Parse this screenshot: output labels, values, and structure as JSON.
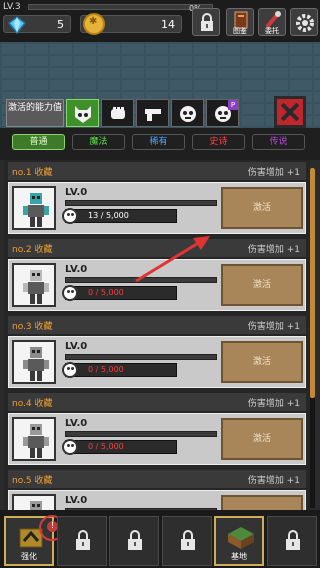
{
  "top": {
    "level": "LV.3",
    "xp_percent_label": "0%",
    "xp_fraction": 0,
    "gems": "5",
    "coins": "14",
    "buttons": [
      {
        "name": "lock-icon",
        "label": ""
      },
      {
        "name": "book-icon",
        "label": "图鉴"
      },
      {
        "name": "wrench-icon",
        "label": "委托"
      },
      {
        "name": "gear-icon",
        "label": ""
      }
    ]
  },
  "abilities": {
    "label": "激活的能力值",
    "icons": [
      "skull-cat-icon",
      "fist-icon",
      "gun-icon",
      "radiation-skull-icon",
      "radiation-skull-p-icon"
    ],
    "active_index": 0,
    "badge": "P"
  },
  "rarity_tabs": [
    {
      "label": "普通",
      "color": "#e8ffd8"
    },
    {
      "label": "魔法",
      "color": "#5fe04a"
    },
    {
      "label": "稀有",
      "color": "#4aa6ff"
    },
    {
      "label": "史诗",
      "color": "#ff4040"
    },
    {
      "label": "传说",
      "color": "#b84ad8"
    }
  ],
  "cards": [
    {
      "no": "no.1 收藏",
      "bonus": "伤害增加 +1",
      "level": "LV.0",
      "souls": "13 / 5,000",
      "souls_fraction": 0.0026,
      "souls_zero": false,
      "activate": "激活"
    },
    {
      "no": "no.2 收藏",
      "bonus": "伤害增加 +1",
      "level": "LV.0",
      "souls": "0 / 5,000",
      "souls_fraction": 0,
      "souls_zero": true,
      "activate": "激活"
    },
    {
      "no": "no.3 收藏",
      "bonus": "伤害增加 +1",
      "level": "LV.0",
      "souls": "0 / 5,000",
      "souls_fraction": 0,
      "souls_zero": true,
      "activate": "激活"
    },
    {
      "no": "no.4 收藏",
      "bonus": "伤害增加 +1",
      "level": "LV.0",
      "souls": "0 / 5,000",
      "souls_fraction": 0,
      "souls_zero": true,
      "activate": "激活"
    },
    {
      "no": "no.5 收藏",
      "bonus": "伤害增加 +1",
      "level": "LV.0",
      "souls": "",
      "souls_fraction": 0,
      "souls_zero": true,
      "activate": ""
    }
  ],
  "bottom_nav": [
    {
      "name": "nav-upgrade",
      "label": "强化",
      "icon": "upgrade-icon",
      "locked": false
    },
    {
      "name": "nav-slot-2",
      "label": "",
      "icon": "lock-icon",
      "locked": true
    },
    {
      "name": "nav-slot-3",
      "label": "",
      "icon": "lock-icon",
      "locked": true
    },
    {
      "name": "nav-slot-4",
      "label": "",
      "icon": "lock-icon",
      "locked": true
    },
    {
      "name": "nav-base",
      "label": "基地",
      "icon": "base-icon",
      "locked": false
    },
    {
      "name": "nav-slot-6",
      "label": "",
      "icon": "lock-icon",
      "locked": true
    }
  ],
  "colors": {
    "accent_green": "#3d7a29",
    "activate_button": "#a9865a",
    "alert_red": "#d83a3a",
    "scroll_thumb": "#c08a36"
  }
}
